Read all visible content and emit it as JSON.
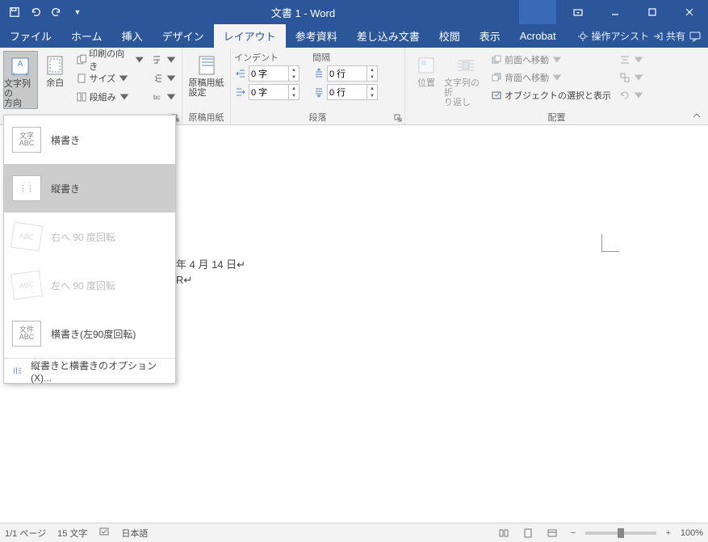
{
  "title": "文書 1  -  Word",
  "qat": {
    "save": "save",
    "undo": "undo",
    "redo": "redo",
    "custom": "▼"
  },
  "tabs": [
    "ファイル",
    "ホーム",
    "挿入",
    "デザイン",
    "レイアウト",
    "参考資料",
    "差し込み文書",
    "校閲",
    "表示",
    "Acrobat"
  ],
  "active_tab": 4,
  "tell_me": "操作アシスト",
  "share": "共有",
  "ribbon": {
    "orientation": {
      "label": "文字列の\n方向"
    },
    "margins": {
      "label": "余白"
    },
    "page_setup": {
      "orientation_label": "印刷の向き",
      "size_label": "サイズ",
      "columns_label": "段組み"
    },
    "manuscript": {
      "btn": "原稿用紙\n設定",
      "group": "原稿用紙"
    },
    "paragraph": {
      "indent_title": "インデント",
      "spacing_title": "間隔",
      "left_val": "0 字",
      "right_val": "0 字",
      "before_val": "0 行",
      "after_val": "0 行",
      "group": "段落"
    },
    "arrange": {
      "position": "位置",
      "wrap": "文字列の折\nり返し",
      "bring_forward": "前面へ移動",
      "send_backward": "背面へ移動",
      "selection_pane": "オブジェクトの選択と表示",
      "group": "配置"
    }
  },
  "dropdown": {
    "items": [
      {
        "label": "横書き",
        "ico": "文字\nABC",
        "sel": false,
        "dis": false
      },
      {
        "label": "縦書き",
        "ico": "⋮",
        "sel": true,
        "dis": false
      },
      {
        "label": "右へ 90 度回転",
        "ico": "ABC",
        "sel": false,
        "dis": true
      },
      {
        "label": "左へ 90 度回転",
        "ico": "ABC",
        "sel": false,
        "dis": true
      },
      {
        "label": "横書き(左90度回転)",
        "ico": "文件\nABC",
        "sel": false,
        "dis": false
      }
    ],
    "options": "縦書きと横書きのオプション(X)..."
  },
  "doc": {
    "line1": "年 4 月 14 日↵",
    "line2": "R↵"
  },
  "status": {
    "pages": "1/1 ページ",
    "words": "15 文字",
    "lang": "日本語",
    "zoom": "100%"
  }
}
